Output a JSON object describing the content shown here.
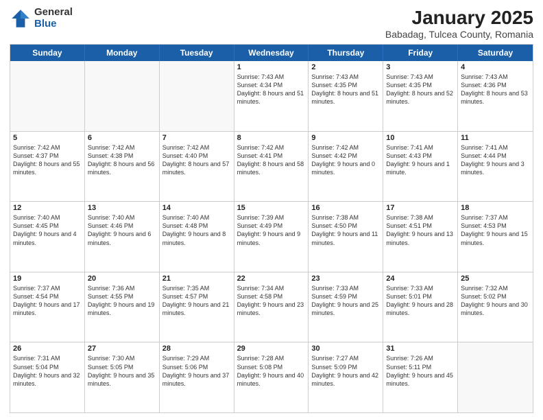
{
  "logo": {
    "general": "General",
    "blue": "Blue"
  },
  "title": "January 2025",
  "location": "Babadag, Tulcea County, Romania",
  "days_header": [
    "Sunday",
    "Monday",
    "Tuesday",
    "Wednesday",
    "Thursday",
    "Friday",
    "Saturday"
  ],
  "weeks": [
    [
      {
        "num": "",
        "text": "",
        "empty": true
      },
      {
        "num": "",
        "text": "",
        "empty": true
      },
      {
        "num": "",
        "text": "",
        "empty": true
      },
      {
        "num": "1",
        "text": "Sunrise: 7:43 AM\nSunset: 4:34 PM\nDaylight: 8 hours and 51 minutes.",
        "empty": false
      },
      {
        "num": "2",
        "text": "Sunrise: 7:43 AM\nSunset: 4:35 PM\nDaylight: 8 hours and 51 minutes.",
        "empty": false
      },
      {
        "num": "3",
        "text": "Sunrise: 7:43 AM\nSunset: 4:35 PM\nDaylight: 8 hours and 52 minutes.",
        "empty": false
      },
      {
        "num": "4",
        "text": "Sunrise: 7:43 AM\nSunset: 4:36 PM\nDaylight: 8 hours and 53 minutes.",
        "empty": false
      }
    ],
    [
      {
        "num": "5",
        "text": "Sunrise: 7:42 AM\nSunset: 4:37 PM\nDaylight: 8 hours and 55 minutes.",
        "empty": false
      },
      {
        "num": "6",
        "text": "Sunrise: 7:42 AM\nSunset: 4:38 PM\nDaylight: 8 hours and 56 minutes.",
        "empty": false
      },
      {
        "num": "7",
        "text": "Sunrise: 7:42 AM\nSunset: 4:40 PM\nDaylight: 8 hours and 57 minutes.",
        "empty": false
      },
      {
        "num": "8",
        "text": "Sunrise: 7:42 AM\nSunset: 4:41 PM\nDaylight: 8 hours and 58 minutes.",
        "empty": false
      },
      {
        "num": "9",
        "text": "Sunrise: 7:42 AM\nSunset: 4:42 PM\nDaylight: 9 hours and 0 minutes.",
        "empty": false
      },
      {
        "num": "10",
        "text": "Sunrise: 7:41 AM\nSunset: 4:43 PM\nDaylight: 9 hours and 1 minute.",
        "empty": false
      },
      {
        "num": "11",
        "text": "Sunrise: 7:41 AM\nSunset: 4:44 PM\nDaylight: 9 hours and 3 minutes.",
        "empty": false
      }
    ],
    [
      {
        "num": "12",
        "text": "Sunrise: 7:40 AM\nSunset: 4:45 PM\nDaylight: 9 hours and 4 minutes.",
        "empty": false
      },
      {
        "num": "13",
        "text": "Sunrise: 7:40 AM\nSunset: 4:46 PM\nDaylight: 9 hours and 6 minutes.",
        "empty": false
      },
      {
        "num": "14",
        "text": "Sunrise: 7:40 AM\nSunset: 4:48 PM\nDaylight: 9 hours and 8 minutes.",
        "empty": false
      },
      {
        "num": "15",
        "text": "Sunrise: 7:39 AM\nSunset: 4:49 PM\nDaylight: 9 hours and 9 minutes.",
        "empty": false
      },
      {
        "num": "16",
        "text": "Sunrise: 7:38 AM\nSunset: 4:50 PM\nDaylight: 9 hours and 11 minutes.",
        "empty": false
      },
      {
        "num": "17",
        "text": "Sunrise: 7:38 AM\nSunset: 4:51 PM\nDaylight: 9 hours and 13 minutes.",
        "empty": false
      },
      {
        "num": "18",
        "text": "Sunrise: 7:37 AM\nSunset: 4:53 PM\nDaylight: 9 hours and 15 minutes.",
        "empty": false
      }
    ],
    [
      {
        "num": "19",
        "text": "Sunrise: 7:37 AM\nSunset: 4:54 PM\nDaylight: 9 hours and 17 minutes.",
        "empty": false
      },
      {
        "num": "20",
        "text": "Sunrise: 7:36 AM\nSunset: 4:55 PM\nDaylight: 9 hours and 19 minutes.",
        "empty": false
      },
      {
        "num": "21",
        "text": "Sunrise: 7:35 AM\nSunset: 4:57 PM\nDaylight: 9 hours and 21 minutes.",
        "empty": false
      },
      {
        "num": "22",
        "text": "Sunrise: 7:34 AM\nSunset: 4:58 PM\nDaylight: 9 hours and 23 minutes.",
        "empty": false
      },
      {
        "num": "23",
        "text": "Sunrise: 7:33 AM\nSunset: 4:59 PM\nDaylight: 9 hours and 25 minutes.",
        "empty": false
      },
      {
        "num": "24",
        "text": "Sunrise: 7:33 AM\nSunset: 5:01 PM\nDaylight: 9 hours and 28 minutes.",
        "empty": false
      },
      {
        "num": "25",
        "text": "Sunrise: 7:32 AM\nSunset: 5:02 PM\nDaylight: 9 hours and 30 minutes.",
        "empty": false
      }
    ],
    [
      {
        "num": "26",
        "text": "Sunrise: 7:31 AM\nSunset: 5:04 PM\nDaylight: 9 hours and 32 minutes.",
        "empty": false
      },
      {
        "num": "27",
        "text": "Sunrise: 7:30 AM\nSunset: 5:05 PM\nDaylight: 9 hours and 35 minutes.",
        "empty": false
      },
      {
        "num": "28",
        "text": "Sunrise: 7:29 AM\nSunset: 5:06 PM\nDaylight: 9 hours and 37 minutes.",
        "empty": false
      },
      {
        "num": "29",
        "text": "Sunrise: 7:28 AM\nSunset: 5:08 PM\nDaylight: 9 hours and 40 minutes.",
        "empty": false
      },
      {
        "num": "30",
        "text": "Sunrise: 7:27 AM\nSunset: 5:09 PM\nDaylight: 9 hours and 42 minutes.",
        "empty": false
      },
      {
        "num": "31",
        "text": "Sunrise: 7:26 AM\nSunset: 5:11 PM\nDaylight: 9 hours and 45 minutes.",
        "empty": false
      },
      {
        "num": "",
        "text": "",
        "empty": true
      }
    ]
  ]
}
